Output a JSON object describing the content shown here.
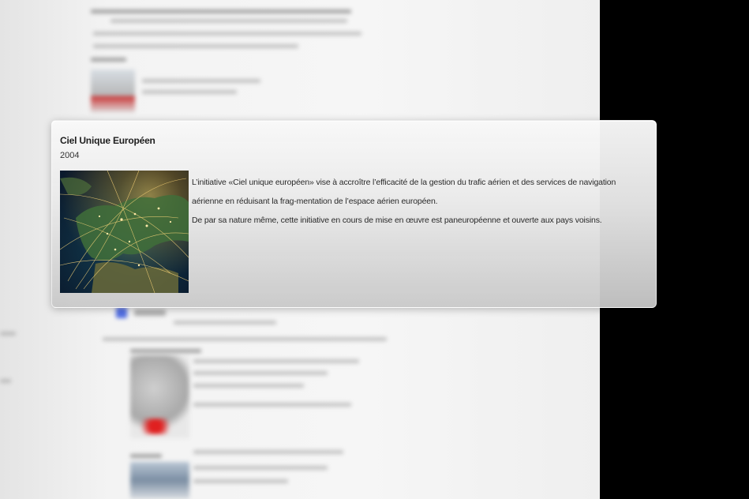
{
  "popover": {
    "title": "Ciel Unique Européen",
    "year": "2004",
    "image_icon": "europe-night-map-image",
    "paragraph_1": "L’initiative «Ciel unique européen» vise à accroître l’efficacité de la gestion du trafic aérien et des services de navigation aérienne en réduisant la frag-mentation de l’espace aérien européen.",
    "paragraph_2": "De par sa nature même, cette initiative en cours de mise en œuvre est paneuropéenne et ouverte aux pays voisins."
  },
  "colors": {
    "page_background": "#000000",
    "document_background": "#f3f3f3",
    "card_background": "#e8e8e8",
    "title_text": "#1e1e1e"
  }
}
